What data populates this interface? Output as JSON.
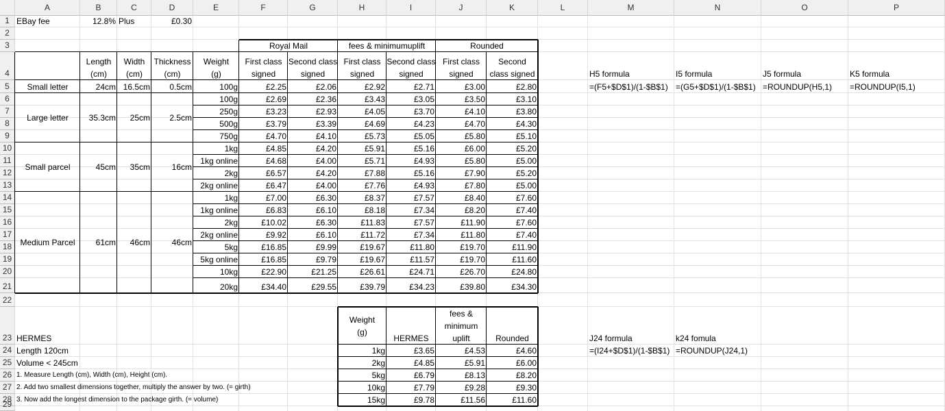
{
  "columns": [
    "A",
    "B",
    "C",
    "D",
    "E",
    "F",
    "G",
    "H",
    "I",
    "J",
    "K",
    "L",
    "M",
    "N",
    "O",
    "P"
  ],
  "rows": [
    "1",
    "2",
    "3",
    "4",
    "5",
    "6",
    "7",
    "8",
    "9",
    "10",
    "11",
    "12",
    "13",
    "14",
    "15",
    "16",
    "17",
    "18",
    "19",
    "20",
    "21",
    "22",
    "23",
    "24",
    "25",
    "26",
    "27",
    "28",
    "29"
  ],
  "r1": {
    "a": "EBay fee",
    "b": "12.8%",
    "c": "Plus",
    "d": "£0.30"
  },
  "group_headers": {
    "royal_mail": "Royal Mail",
    "fees": "fees & minimumuplift",
    "rounded": "Rounded"
  },
  "headers": {
    "b1": "Length",
    "b2": "(cm)",
    "c1": "Width",
    "c2": "(cm)",
    "d1": "Thickness",
    "d2": "(cm)",
    "e1": "Weight",
    "e2": "(g)",
    "f1": "First class",
    "f2": "signed",
    "g1": "Second class",
    "g2": "signed",
    "h1": "First class",
    "h2": "signed",
    "i1": "Second class",
    "i2": "signed",
    "j1": "First class",
    "j2": "signed",
    "k1": "Second",
    "k2": "class signed"
  },
  "categories": [
    {
      "name": "Small letter",
      "length": "24cm",
      "width": "16.5cm",
      "thickness": "0.5cm"
    },
    {
      "name": "Large letter",
      "length": "35.3cm",
      "width": "25cm",
      "thickness": "2.5cm"
    },
    {
      "name": "Small parcel",
      "length": "45cm",
      "width": "35cm",
      "thickness": "16cm"
    },
    {
      "name": "Medium Parcel",
      "length": "61cm",
      "width": "46cm",
      "thickness": "46cm"
    }
  ],
  "rates": [
    [
      "100g",
      "£2.25",
      "£2.06",
      "£2.92",
      "£2.71",
      "£3.00",
      "£2.80"
    ],
    [
      "100g",
      "£2.69",
      "£2.36",
      "£3.43",
      "£3.05",
      "£3.50",
      "£3.10"
    ],
    [
      "250g",
      "£3.23",
      "£2.93",
      "£4.05",
      "£3.70",
      "£4.10",
      "£3.80"
    ],
    [
      "500g",
      "£3.79",
      "£3.39",
      "£4.69",
      "£4.23",
      "£4.70",
      "£4.30"
    ],
    [
      "750g",
      "£4.70",
      "£4.10",
      "£5.73",
      "£5.05",
      "£5.80",
      "£5.10"
    ],
    [
      "1kg",
      "£4.85",
      "£4.20",
      "£5.91",
      "£5.16",
      "£6.00",
      "£5.20"
    ],
    [
      "1kg online",
      "£4.68",
      "£4.00",
      "£5.71",
      "£4.93",
      "£5.80",
      "£5.00"
    ],
    [
      "2kg",
      "£6.57",
      "£4.20",
      "£7.88",
      "£5.16",
      "£7.90",
      "£5.20"
    ],
    [
      "2kg online",
      "£6.47",
      "£4.00",
      "£7.76",
      "£4.93",
      "£7.80",
      "£5.00"
    ],
    [
      "1kg",
      "£7.00",
      "£6.30",
      "£8.37",
      "£7.57",
      "£8.40",
      "£7.60"
    ],
    [
      "1kg online",
      "£6.83",
      "£6.10",
      "£8.18",
      "£7.34",
      "£8.20",
      "£7.40"
    ],
    [
      "2kg",
      "£10.02",
      "£6.30",
      "£11.83",
      "£7.57",
      "£11.90",
      "£7.60"
    ],
    [
      "2kg online",
      "£9.92",
      "£6.10",
      "£11.72",
      "£7.34",
      "£11.80",
      "£7.40"
    ],
    [
      "5kg",
      "£16.85",
      "£9.99",
      "£19.67",
      "£11.80",
      "£19.70",
      "£11.90"
    ],
    [
      "5kg online",
      "£16.85",
      "£9.79",
      "£19.67",
      "£11.57",
      "£19.70",
      "£11.60"
    ],
    [
      "10kg",
      "£22.90",
      "£21.25",
      "£26.61",
      "£24.71",
      "£26.70",
      "£24.80"
    ],
    [
      "20kg",
      "£34.40",
      "£29.55",
      "£39.79",
      "£34.23",
      "£39.80",
      "£34.30"
    ]
  ],
  "formulas": {
    "h5_label": "H5 formula",
    "i5_label": "I5 formula",
    "j5_label": "J5 formula",
    "k5_label": "K5 formula",
    "h5": "=(F5+$D$1)/(1-$B$1)",
    "i5": "=(G5+$D$1)/(1-$B$1)",
    "j5": "=ROUNDUP(H5,1)",
    "k5": "=ROUNDUP(I5,1)",
    "j24_label": "J24 formula",
    "k24_label": "k24 fomula",
    "j24": "=(I24+$D$1)/(1-$B$1)",
    "k24": "=ROUNDUP(J24,1)"
  },
  "hermes": {
    "title": "HERMES",
    "length": "Length 120cm",
    "volume": "Volume < 245cm",
    "step1": "1. Measure Length (cm), Width (cm), Height (cm).",
    "step2": "2. Add two smallest dimensions together, multiply the answer by two. (= girth)",
    "step3": "3. Now add the longest dimension to the package girth. (= volume)",
    "h_weight1": "Weight",
    "h_weight2": "(g)",
    "h_hermes": "HERMES",
    "h_fees1": "fees &",
    "h_fees2": "minimum",
    "h_fees3": "uplift",
    "h_rounded": "Rounded",
    "rows": [
      [
        "1kg",
        "£3.65",
        "£4.53",
        "£4.60"
      ],
      [
        "2kg",
        "£4.85",
        "£5.91",
        "£6.00"
      ],
      [
        "5kg",
        "£6.79",
        "£8.13",
        "£8.20"
      ],
      [
        "10kg",
        "£7.79",
        "£9.28",
        "£9.30"
      ],
      [
        "15kg",
        "£9.78",
        "£11.56",
        "£11.60"
      ]
    ]
  }
}
